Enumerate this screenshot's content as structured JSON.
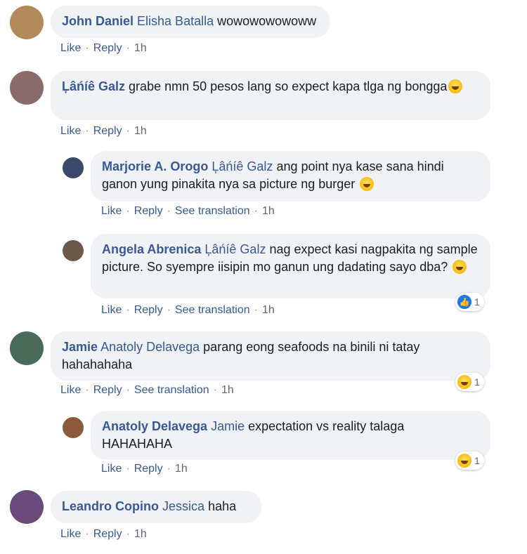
{
  "actions": {
    "like": "Like",
    "reply": "Reply",
    "see_translation": "See translation",
    "separator": "·"
  },
  "comments": [
    {
      "author": "John Daniel",
      "tagged": "Elisha Batalla",
      "text": "wowowowowoww",
      "time": "1h",
      "avatar_color": "#b08a5a"
    },
    {
      "author": "Ļâńíê Galz",
      "tagged": "",
      "text": "grabe nmn 50 pesos lang so expect kapa tlga ng bongga",
      "time": "1h",
      "avatar_color": "#8a6a6a",
      "emoji": "laughing-emoji"
    },
    {
      "author": "Marjorie A. Orogo",
      "tagged": "Ļâńíê Galz",
      "text": "ang point nya kase sana hindi ganon yung pinakita nya sa picture ng burger",
      "time": "1h",
      "avatar_color": "#3b4a6b",
      "emoji": "laughing-emoji"
    },
    {
      "author": "Angela Abrenica",
      "tagged": "Ļâńíê Galz",
      "text": "nag expect kasi nagpakita ng sample picture. So syempre iisipin mo ganun ung dadating sayo dba?",
      "time": "1h",
      "avatar_color": "#6b5a4a",
      "emoji": "laughing-emoji",
      "reaction": {
        "type": "like",
        "count": "1"
      }
    },
    {
      "author": "Jamie",
      "tagged": "Anatoly Delavega",
      "text": "parang eong seafoods na binili ni tatay hahahahaha",
      "time": "1h",
      "avatar_color": "#4a6a5a",
      "reaction": {
        "type": "haha",
        "count": "1"
      }
    },
    {
      "author": "Anatoly Delavega",
      "tagged": "Jamie",
      "text": "expectation vs reality talaga HAHAHAHA",
      "time": "1h",
      "avatar_color": "#8a5a3a",
      "reaction": {
        "type": "haha",
        "count": "1"
      }
    },
    {
      "author": "Leandro Copino",
      "tagged": "Jessica",
      "text": "haha",
      "time": "1h",
      "avatar_color": "#6a4a7a"
    }
  ]
}
